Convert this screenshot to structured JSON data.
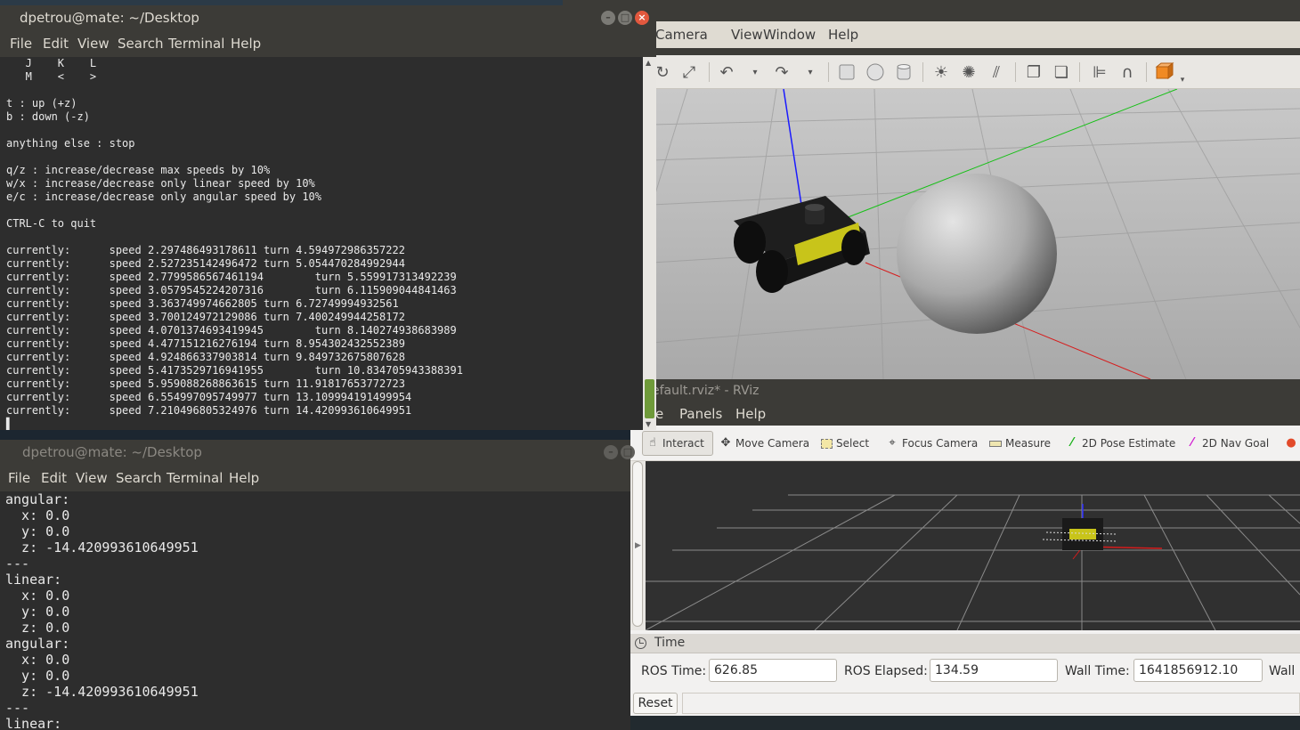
{
  "terminal_top": {
    "title": "dpetrou@mate: ~/Desktop",
    "menu": [
      "File",
      "Edit",
      "View",
      "Search",
      "Terminal",
      "Help"
    ],
    "lines": [
      "   J    K    L",
      "   M    <    >",
      "",
      "t : up (+z)",
      "b : down (-z)",
      "",
      "anything else : stop",
      "",
      "q/z : increase/decrease max speeds by 10%",
      "w/x : increase/decrease only linear speed by 10%",
      "e/c : increase/decrease only angular speed by 10%",
      "",
      "CTRL-C to quit",
      "",
      "currently:      speed 2.297486493178611 turn 4.594972986357222",
      "currently:      speed 2.527235142496472 turn 5.054470284992944",
      "currently:      speed 2.7799586567461194        turn 5.559917313492239",
      "currently:      speed 3.0579545224207316        turn 6.115909044841463",
      "currently:      speed 3.363749974662805 turn 6.72749994932561",
      "currently:      speed 3.700124972129086 turn 7.400249944258172",
      "currently:      speed 4.0701374693419945        turn 8.140274938683989",
      "currently:      speed 4.477151216276194 turn 8.954302432552389",
      "currently:      speed 4.924866337903814 turn 9.849732675807628",
      "currently:      speed 5.4173529716941955        turn 10.834705943388391",
      "currently:      speed 5.959088268863615 turn 11.91817653772723",
      "currently:      speed 6.554997095749977 turn 13.109994191499954",
      "currently:      speed 7.210496805324976 turn 14.420993610649951"
    ],
    "cursor": "▌"
  },
  "terminal_bottom": {
    "title": "dpetrou@mate: ~/Desktop",
    "menu": [
      "File",
      "Edit",
      "View",
      "Search",
      "Terminal",
      "Help"
    ],
    "lines": [
      "angular:",
      "  x: 0.0",
      "  y: 0.0",
      "  z: -14.420993610649951",
      "---",
      "linear:",
      "  x: 0.0",
      "  y: 0.0",
      "  z: 0.0",
      "angular:",
      "  x: 0.0",
      "  y: 0.0",
      "  z: -14.420993610649951",
      "---",
      "linear:"
    ]
  },
  "gazebo": {
    "menu": [
      "Camera",
      "View",
      "Window",
      "Help"
    ]
  },
  "rviz": {
    "title": "efault.rviz* - RViz",
    "menu": [
      "e",
      "Panels",
      "Help"
    ],
    "tools": [
      {
        "label": "Interact",
        "icon": "hand-icon"
      },
      {
        "label": "Move Camera",
        "icon": "move-camera-icon"
      },
      {
        "label": "Select",
        "icon": "select-icon"
      },
      {
        "label": "Focus Camera",
        "icon": "focus-camera-icon"
      },
      {
        "label": "Measure",
        "icon": "measure-icon"
      },
      {
        "label": "2D Pose Estimate",
        "icon": "pose-estimate-icon"
      },
      {
        "label": "2D Nav Goal",
        "icon": "nav-goal-icon"
      }
    ],
    "time_panel": {
      "title": "Time",
      "ros_time_label": "ROS Time:",
      "ros_time": "626.85",
      "ros_elapsed_label": "ROS Elapsed:",
      "ros_elapsed": "134.59",
      "wall_time_label": "Wall Time:",
      "wall_time": "1641856912.10",
      "wall_elapsed_label": "Wall E",
      "reset_label": "Reset"
    }
  },
  "colors": {
    "terminal_bg": "#2d2d2d",
    "titlebar": "#3c3b37",
    "robot_body": "#1b1b1b",
    "robot_accent": "#c8c41a"
  }
}
